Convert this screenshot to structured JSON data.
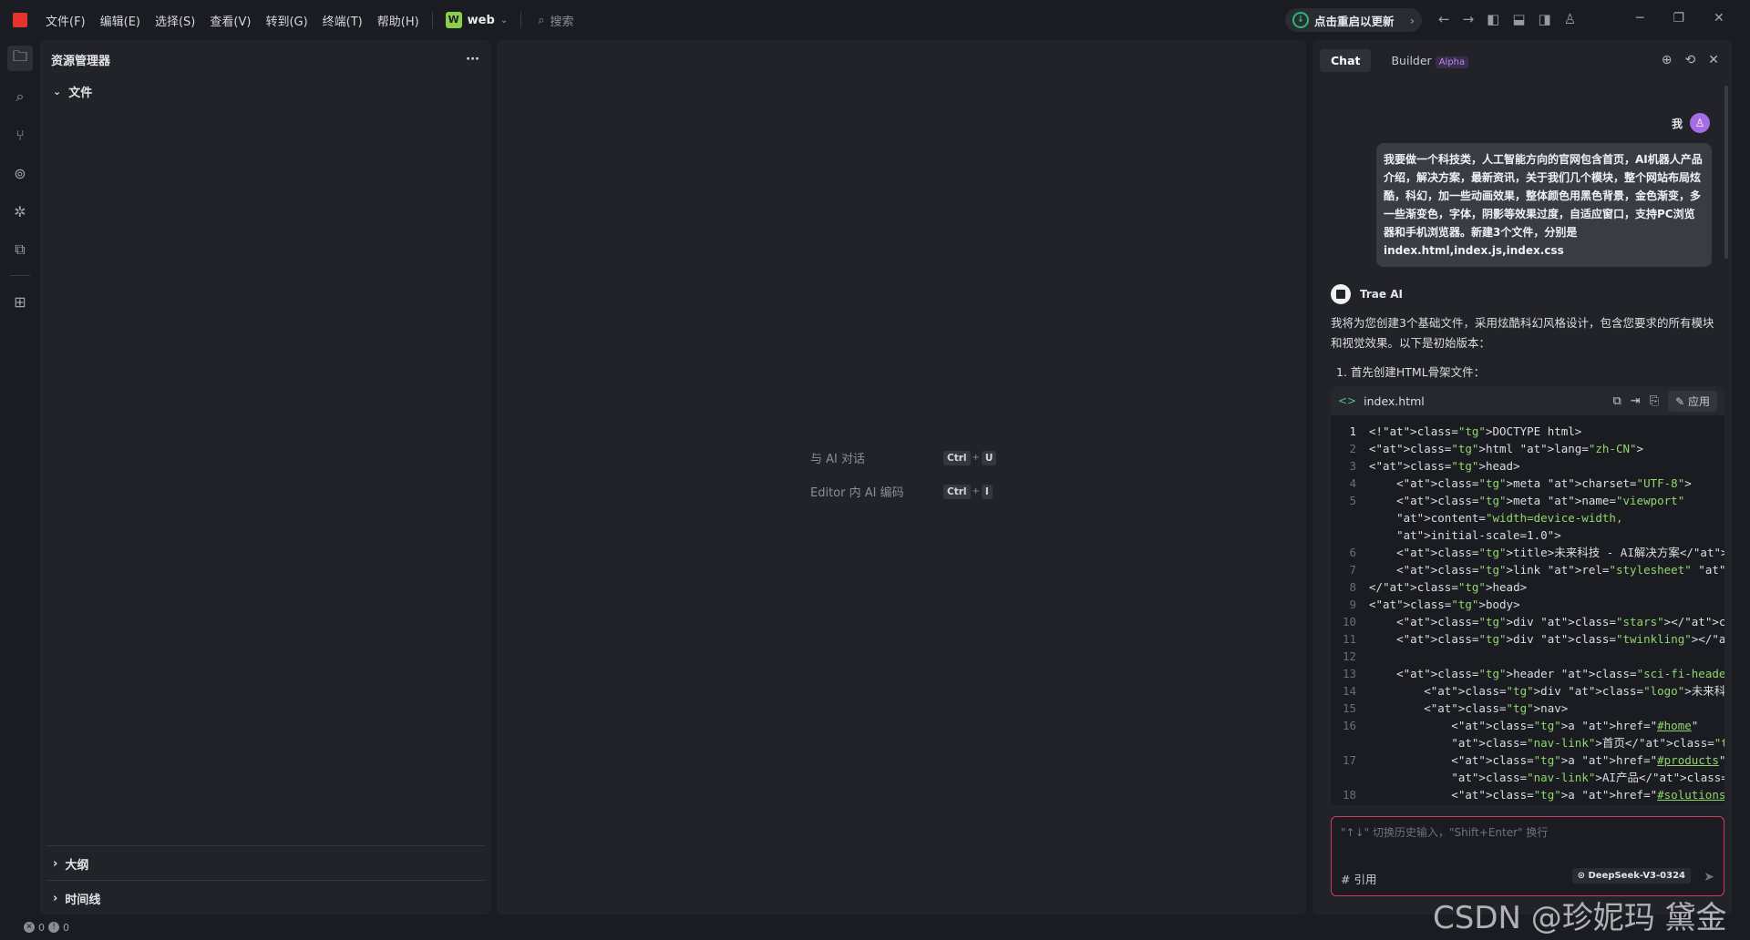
{
  "titlebar": {
    "menu": [
      "文件(F)",
      "编辑(E)",
      "选择(S)",
      "查看(V)",
      "转到(G)",
      "终端(T)",
      "帮助(H)"
    ],
    "project_badge": "W",
    "project_name": "web",
    "search_placeholder": "搜索",
    "update_label": "点击重启以更新"
  },
  "explorer": {
    "title": "资源管理器",
    "more": "···",
    "folder": "文件",
    "outline": "大纲",
    "timeline": "时间线"
  },
  "editor": {
    "hints": [
      {
        "label": "与 AI 对话",
        "keys": [
          "Ctrl",
          "U"
        ]
      },
      {
        "label": "Editor 内 AI 编码",
        "keys": [
          "Ctrl",
          "I"
        ]
      }
    ]
  },
  "chat": {
    "tab_chat": "Chat",
    "tab_builder": "Builder",
    "alpha": "Alpha",
    "me_label": "我",
    "user_message": "我要做一个科技类，人工智能方向的官网包含首页，AI机器人产品介绍，解决方案，最新资讯，关于我们几个模块，整个网站布局炫酷，科幻，加一些动画效果，整体颜色用黑色背景，金色渐变，多一些渐变色，字体，阴影等效果过度，自适应窗口，支持PC浏览器和手机浏览器。新建3个文件，分别是index.html,index.js,index.css",
    "ai_name": "Trae AI",
    "ai_text": "我将为您创建3个基础文件，采用炫酷科幻风格设计，包含您要求的所有模块和视觉效果。以下是初始版本：",
    "ai_step": "1. 首先创建HTML骨架文件：",
    "code_file": "index.html",
    "apply_label": "应用",
    "input_placeholder": "\"↑↓\" 切换历史输入，\"Shift+Enter\" 换行",
    "ref_label": "# 引用",
    "model": "DeepSeek-V3-0324"
  },
  "code_lines": [
    {
      "n": "1",
      "t": "<!DOCTYPE html>"
    },
    {
      "n": "2",
      "t": "<html lang=\"zh-CN\">"
    },
    {
      "n": "3",
      "t": "<head>"
    },
    {
      "n": "4",
      "t": "    <meta charset=\"UTF-8\">"
    },
    {
      "n": "5",
      "t": "    <meta name=\"viewport\""
    },
    {
      "n": "",
      "t": "    content=\"width=device-width,"
    },
    {
      "n": "",
      "t": "    initial-scale=1.0\">"
    },
    {
      "n": "6",
      "t": "    <title>未来科技 - AI解决方案</title>"
    },
    {
      "n": "7",
      "t": "    <link rel=\"stylesheet\" href=\"index.css\">"
    },
    {
      "n": "8",
      "t": "</head>"
    },
    {
      "n": "9",
      "t": "<body>"
    },
    {
      "n": "10",
      "t": "    <div class=\"stars\"></div>"
    },
    {
      "n": "11",
      "t": "    <div class=\"twinkling\"></div>"
    },
    {
      "n": "12",
      "t": ""
    },
    {
      "n": "13",
      "t": "    <header class=\"sci-fi-header\">"
    },
    {
      "n": "14",
      "t": "        <div class=\"logo\">未来科技</div>"
    },
    {
      "n": "15",
      "t": "        <nav>"
    },
    {
      "n": "16",
      "t": "            <a href=\"#home\""
    },
    {
      "n": "",
      "t": "            class=\"nav-link\">首页</a>"
    },
    {
      "n": "17",
      "t": "            <a href=\"#products\""
    },
    {
      "n": "",
      "t": "            class=\"nav-link\">AI产品</a>"
    },
    {
      "n": "18",
      "t": "            <a href=\"#solutions\""
    }
  ],
  "status": {
    "errors": "0",
    "warnings": "0"
  },
  "watermark": "CSDN @珍妮玛 黛金"
}
